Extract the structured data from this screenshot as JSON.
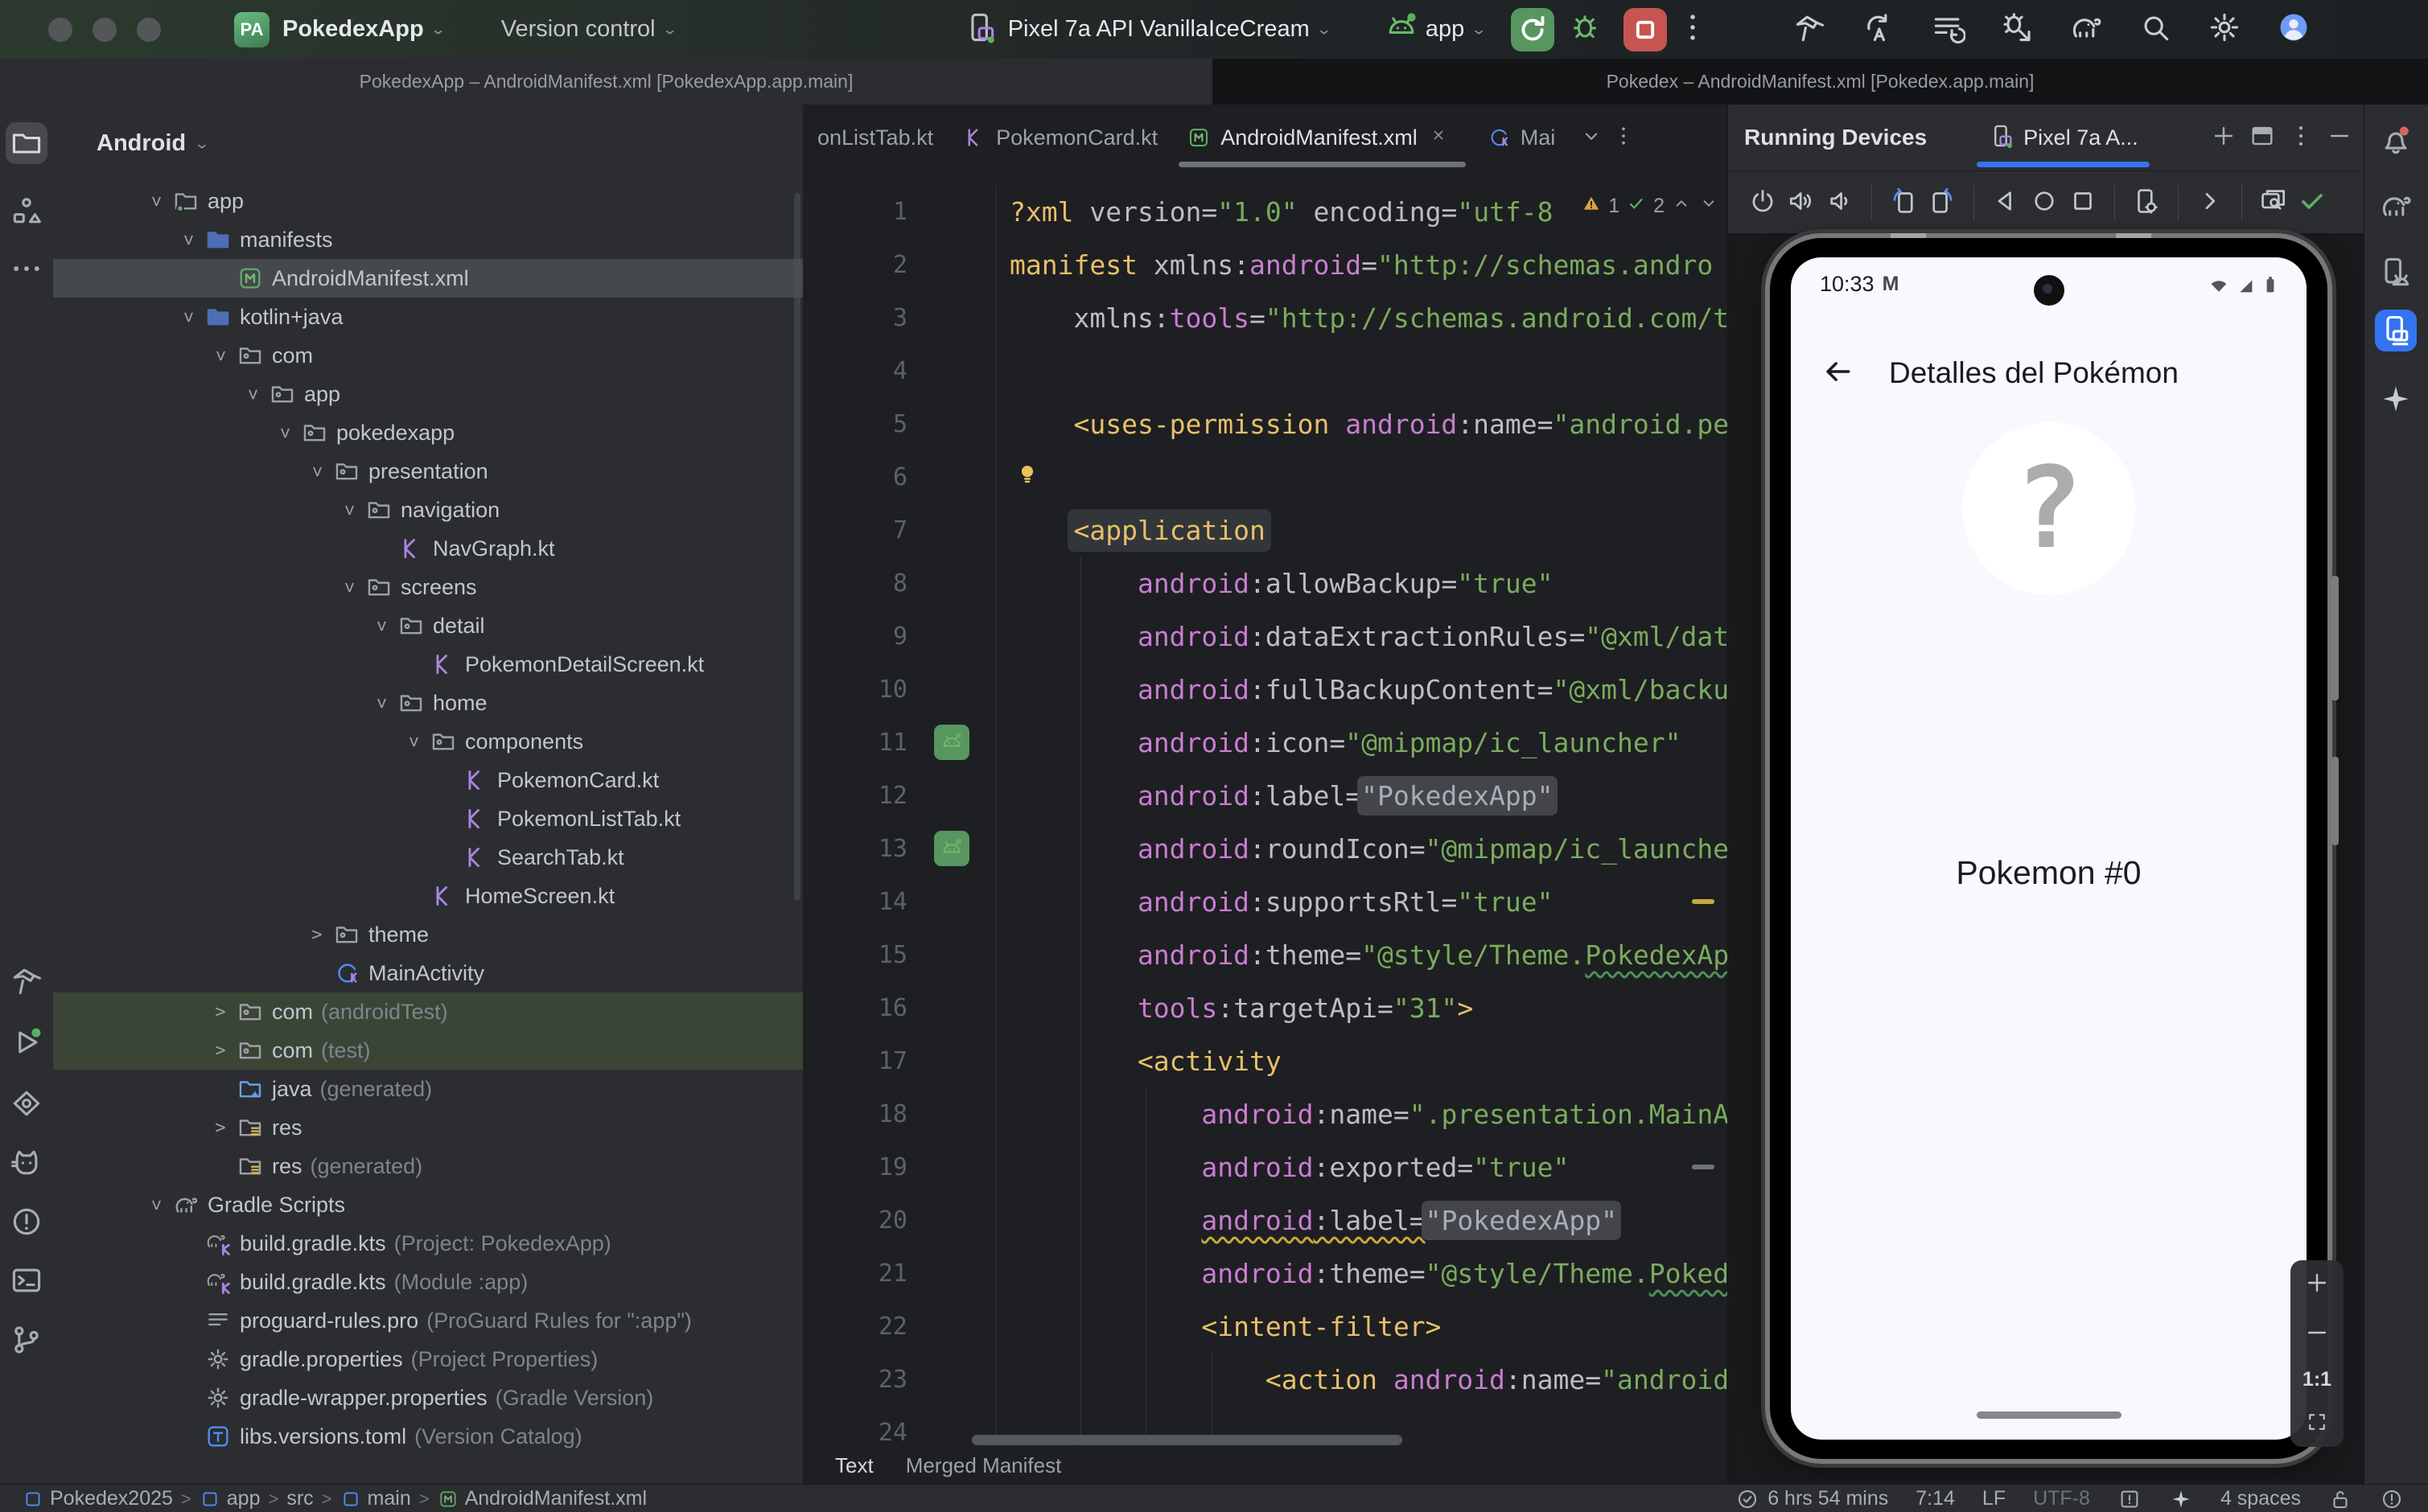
{
  "titlebar": {
    "project_badge": "PA",
    "project": "PokedexApp",
    "vcs": "Version control",
    "device": "Pixel 7a API VanillaIceCream",
    "run_config": "app"
  },
  "window_titles": {
    "left": "PokedexApp – AndroidManifest.xml [PokedexApp.app.main]",
    "right": "Pokedex – AndroidManifest.xml [Pokedex.app.main]"
  },
  "colors": {
    "accent": "#3574F0",
    "run_green": "#57965F",
    "stop_red": "#C75450",
    "xml_tag": "#E8BF6A",
    "xml_prefix": "#C87DD1",
    "xml_string": "#7AAB5E"
  },
  "project": {
    "header": "Android",
    "items": [
      {
        "lvl": 0,
        "st": "o",
        "ic": "folder-app",
        "label": "app"
      },
      {
        "lvl": 1,
        "st": "o",
        "ic": "folder-blue",
        "label": "manifests"
      },
      {
        "lvl": 2,
        "st": "",
        "ic": "manifest",
        "label": "AndroidManifest.xml",
        "sel": true
      },
      {
        "lvl": 1,
        "st": "o",
        "ic": "folder-blue",
        "label": "kotlin+java"
      },
      {
        "lvl": 2,
        "st": "o",
        "ic": "pkg",
        "label": "com"
      },
      {
        "lvl": 3,
        "st": "o",
        "ic": "pkg",
        "label": "app"
      },
      {
        "lvl": 4,
        "st": "o",
        "ic": "pkg",
        "label": "pokedexapp"
      },
      {
        "lvl": 5,
        "st": "o",
        "ic": "pkg",
        "label": "presentation"
      },
      {
        "lvl": 6,
        "st": "o",
        "ic": "pkg",
        "label": "navigation"
      },
      {
        "lvl": 7,
        "st": "",
        "ic": "kt",
        "label": "NavGraph.kt"
      },
      {
        "lvl": 6,
        "st": "o",
        "ic": "pkg",
        "label": "screens"
      },
      {
        "lvl": 7,
        "st": "o",
        "ic": "pkg",
        "label": "detail"
      },
      {
        "lvl": 8,
        "st": "",
        "ic": "kt",
        "label": "PokemonDetailScreen.kt"
      },
      {
        "lvl": 7,
        "st": "o",
        "ic": "pkg",
        "label": "home"
      },
      {
        "lvl": 8,
        "st": "o",
        "ic": "pkg",
        "label": "components"
      },
      {
        "lvl": 9,
        "st": "",
        "ic": "kt",
        "label": "PokemonCard.kt"
      },
      {
        "lvl": 9,
        "st": "",
        "ic": "kt",
        "label": "PokemonListTab.kt"
      },
      {
        "lvl": 9,
        "st": "",
        "ic": "kt",
        "label": "SearchTab.kt"
      },
      {
        "lvl": 8,
        "st": "",
        "ic": "kt",
        "label": "HomeScreen.kt"
      },
      {
        "lvl": 5,
        "st": "c",
        "ic": "pkg",
        "label": "theme"
      },
      {
        "lvl": 5,
        "st": "",
        "ic": "class-kt",
        "label": "MainActivity"
      },
      {
        "lvl": 2,
        "st": "c",
        "ic": "pkg",
        "label": "com",
        "sfx": "(androidTest)",
        "green": true
      },
      {
        "lvl": 2,
        "st": "c",
        "ic": "pkg",
        "label": "com",
        "sfx": "(test)",
        "green": true
      },
      {
        "lvl": 2,
        "st": "",
        "ic": "java-gen",
        "label": "java",
        "sfx": "(generated)"
      },
      {
        "lvl": 2,
        "st": "c",
        "ic": "res",
        "label": "res"
      },
      {
        "lvl": 2,
        "st": "",
        "ic": "res",
        "label": "res",
        "sfx": "(generated)"
      },
      {
        "lvl": 0,
        "st": "o",
        "ic": "gradle",
        "label": "Gradle Scripts"
      },
      {
        "lvl": 1,
        "st": "",
        "ic": "gradle-kt",
        "label": "build.gradle.kts",
        "sfx": "(Project: PokedexApp)"
      },
      {
        "lvl": 1,
        "st": "",
        "ic": "gradle-kt",
        "label": "build.gradle.kts",
        "sfx": "(Module :app)"
      },
      {
        "lvl": 1,
        "st": "",
        "ic": "file-text",
        "label": "proguard-rules.pro",
        "sfx": "(ProGuard Rules for \":app\")"
      },
      {
        "lvl": 1,
        "st": "",
        "ic": "gear-file",
        "label": "gradle.properties",
        "sfx": "(Project Properties)"
      },
      {
        "lvl": 1,
        "st": "",
        "ic": "gear-file",
        "label": "gradle-wrapper.properties",
        "sfx": "(Gradle Version)"
      },
      {
        "lvl": 1,
        "st": "",
        "ic": "toml",
        "label": "libs.versions.toml",
        "sfx": "(Version Catalog)"
      }
    ]
  },
  "editor": {
    "tabs": [
      {
        "icon": null,
        "label": "onListTab.kt"
      },
      {
        "icon": "kt",
        "label": "PokemonCard.kt"
      },
      {
        "icon": "manifest",
        "label": "AndroidManifest.xml",
        "close": true,
        "active": true
      },
      {
        "icon": "class-kt",
        "label": "Mai"
      }
    ],
    "inspection": {
      "warnings": "1",
      "ok": "2"
    },
    "bottom_tabs": [
      "Text",
      "Merged Manifest"
    ],
    "lines": [
      {
        "n": "1",
        "tk": [
          [
            "t",
            "?xml"
          ],
          [
            "a",
            " version="
          ],
          [
            "s",
            "\"1.0\""
          ],
          [
            "a",
            " encoding="
          ],
          [
            "s",
            "\"utf-8"
          ]
        ]
      },
      {
        "n": "2",
        "tk": [
          [
            "t",
            "manifest"
          ],
          [
            "a",
            " xmlns:"
          ],
          [
            "n",
            "android"
          ],
          [
            "a",
            "="
          ],
          [
            "s",
            "\"http://schemas.andro"
          ]
        ]
      },
      {
        "n": "3",
        "tk": [
          [
            "a",
            "    xmlns:"
          ],
          [
            "n",
            "tools"
          ],
          [
            "a",
            "="
          ],
          [
            "s",
            "\"http://schemas.android.com/t"
          ]
        ]
      },
      {
        "n": "4",
        "tk": []
      },
      {
        "n": "5",
        "tk": [
          [
            "t",
            "    <uses-permission"
          ],
          [
            "n",
            " android"
          ],
          [
            "a",
            ":name="
          ],
          [
            "s",
            "\"android.pe"
          ]
        ]
      },
      {
        "n": "6",
        "tk": [],
        "bulb": true
      },
      {
        "n": "7",
        "tk": [
          [
            "w",
            "    "
          ],
          [
            "t box",
            "<application"
          ]
        ]
      },
      {
        "n": "8",
        "tk": [
          [
            "n",
            "        android"
          ],
          [
            "a",
            ":allowBackup="
          ],
          [
            "s",
            "\"true\""
          ]
        ]
      },
      {
        "n": "9",
        "tk": [
          [
            "n",
            "        android"
          ],
          [
            "a",
            ":dataExtractionRules="
          ],
          [
            "s",
            "\"@xml/dat"
          ]
        ]
      },
      {
        "n": "10",
        "tk": [
          [
            "n",
            "        android"
          ],
          [
            "a",
            ":fullBackupContent="
          ],
          [
            "s",
            "\"@xml/backu"
          ]
        ]
      },
      {
        "n": "11",
        "g": "android",
        "tk": [
          [
            "n",
            "        android"
          ],
          [
            "a",
            ":icon="
          ],
          [
            "s",
            "\"@mipmap/ic_launcher\""
          ]
        ]
      },
      {
        "n": "12",
        "tk": [
          [
            "n",
            "        android"
          ],
          [
            "a",
            ":label="
          ],
          [
            "hl",
            "\"PokedexApp\""
          ]
        ]
      },
      {
        "n": "13",
        "g": "android",
        "tk": [
          [
            "n",
            "        android"
          ],
          [
            "a",
            ":roundIcon="
          ],
          [
            "s",
            "\"@mipmap/ic_launche"
          ]
        ]
      },
      {
        "n": "14",
        "mark": "y",
        "tk": [
          [
            "n",
            "        android"
          ],
          [
            "a",
            ":supportsRtl="
          ],
          [
            "s",
            "\"true\""
          ]
        ]
      },
      {
        "n": "15",
        "tk": [
          [
            "n",
            "        android"
          ],
          [
            "a",
            ":theme="
          ],
          [
            "s",
            "\"@style/Theme."
          ],
          [
            "sg",
            "PokedexAp"
          ]
        ]
      },
      {
        "n": "16",
        "tk": [
          [
            "n",
            "        tools"
          ],
          [
            "a",
            ":targetApi="
          ],
          [
            "s",
            "\"31\""
          ],
          [
            "t",
            ">"
          ]
        ]
      },
      {
        "n": "17",
        "tk": [
          [
            "t",
            "        <activity"
          ]
        ]
      },
      {
        "n": "18",
        "tk": [
          [
            "n",
            "            android"
          ],
          [
            "a",
            ":name="
          ],
          [
            "s",
            "\".presentation.MainA"
          ]
        ]
      },
      {
        "n": "19",
        "mark": "g",
        "tk": [
          [
            "n",
            "            android"
          ],
          [
            "a",
            ":exported="
          ],
          [
            "s",
            "\"true\""
          ]
        ]
      },
      {
        "n": "20",
        "tk": [
          [
            "w",
            "            "
          ],
          [
            "n uy",
            "android"
          ],
          [
            "a uy",
            ":label="
          ],
          [
            "hl",
            "\"PokedexApp\""
          ]
        ]
      },
      {
        "n": "21",
        "tk": [
          [
            "n",
            "            android"
          ],
          [
            "a",
            ":theme="
          ],
          [
            "s",
            "\"@style/Theme."
          ],
          [
            "sg",
            "Poked"
          ]
        ]
      },
      {
        "n": "22",
        "tk": [
          [
            "t",
            "            <intent-filter>"
          ]
        ]
      },
      {
        "n": "23",
        "tk": [
          [
            "t",
            "                <action"
          ],
          [
            "n",
            " android"
          ],
          [
            "a",
            ":name="
          ],
          [
            "s",
            "\"android"
          ]
        ]
      },
      {
        "n": "24",
        "tk": []
      }
    ]
  },
  "device_panel": {
    "title": "Running Devices",
    "tab_label": "Pixel 7a A...",
    "screen": {
      "time": "10:33",
      "notification_glyph": "M",
      "app_title": "Detalles del Pokémon",
      "placeholder_glyph": "?",
      "caption": "Pokemon #0"
    },
    "zoom_ratio": "1:1"
  },
  "statusbar": {
    "breadcrumbs": [
      {
        "icon": "dir-blue",
        "label": "Pokedex2025"
      },
      {
        "icon": "dir-blue",
        "label": "app"
      },
      {
        "icon": null,
        "label": "src"
      },
      {
        "icon": "dir-blue",
        "label": "main"
      },
      {
        "icon": "manifest",
        "label": "AndroidManifest.xml"
      }
    ],
    "right": [
      {
        "icon": "check-circle",
        "label": "6 hrs 54 mins"
      },
      {
        "icon": null,
        "label": "7:14"
      },
      {
        "icon": null,
        "label": "LF"
      },
      {
        "icon": null,
        "label": "UTF-8",
        "dim": true
      },
      {
        "icon": "todo-box",
        "label": ""
      },
      {
        "icon": "sparkle",
        "label": ""
      },
      {
        "icon": null,
        "label": "4 spaces"
      },
      {
        "icon": "unlock",
        "label": ""
      },
      {
        "icon": "error-circle",
        "label": ""
      }
    ]
  }
}
